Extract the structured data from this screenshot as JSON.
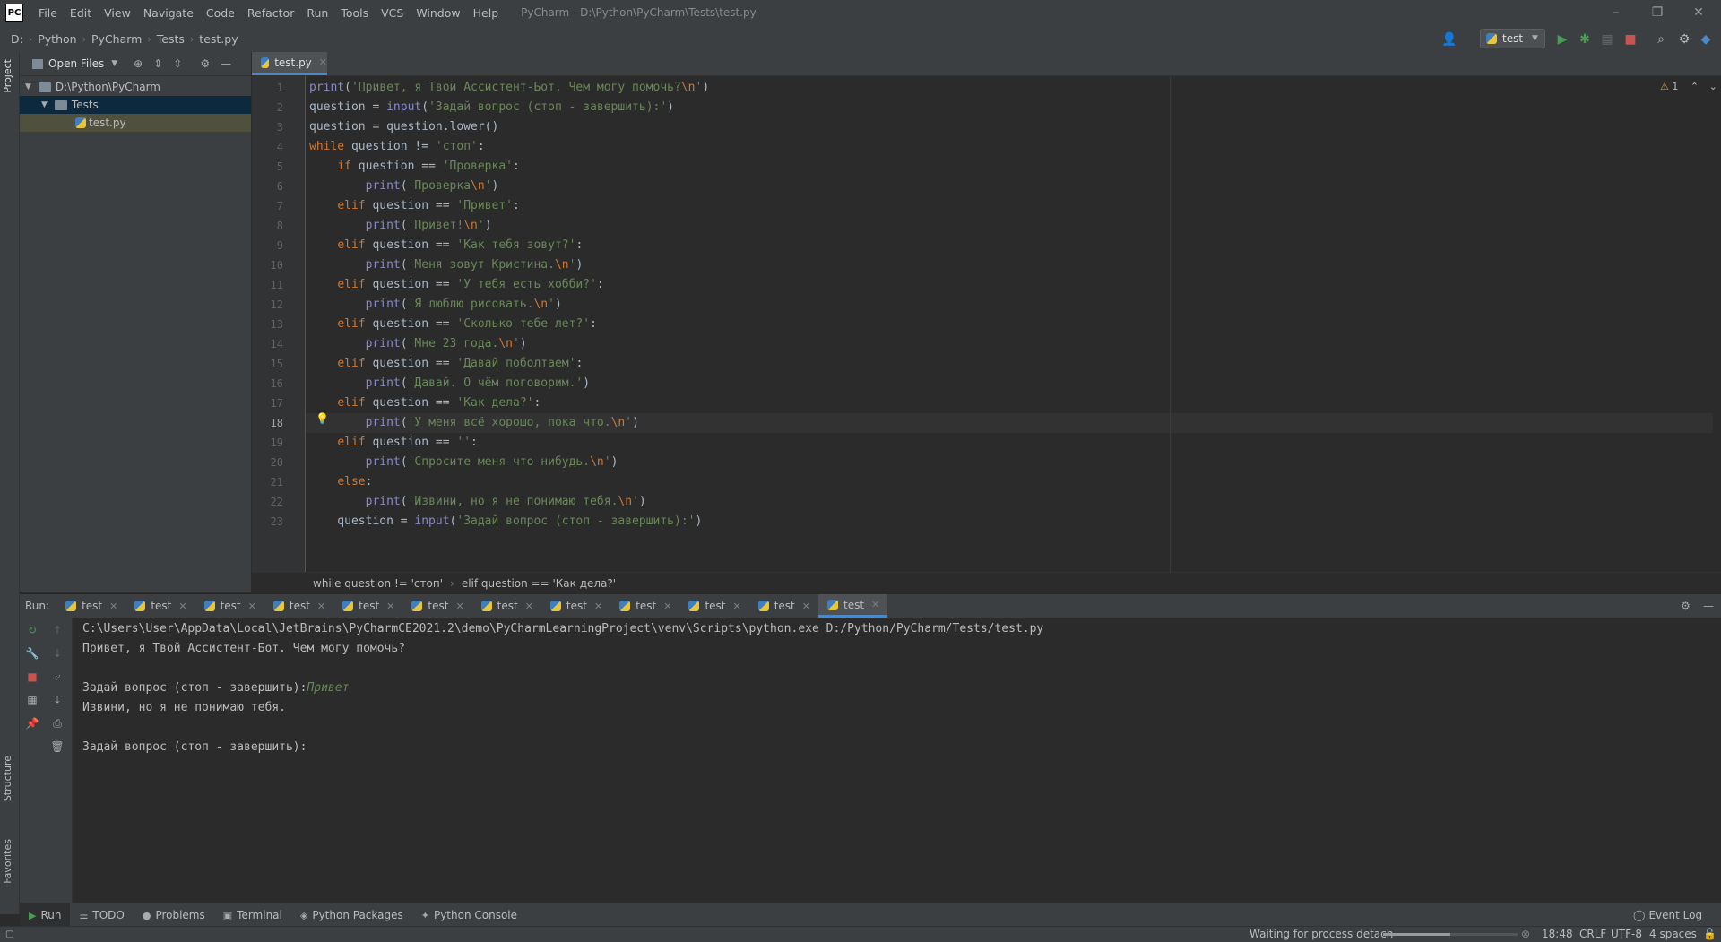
{
  "titlebar": {
    "logo": "PC",
    "menu": [
      "File",
      "Edit",
      "View",
      "Navigate",
      "Code",
      "Refactor",
      "Run",
      "Tools",
      "VCS",
      "Window",
      "Help"
    ],
    "title": "PyCharm - D:\\Python\\PyCharm\\Tests\\test.py",
    "controls": {
      "minimize": "–",
      "restore": "❐",
      "close": "✕"
    }
  },
  "navbar": {
    "breadcrumbs": [
      "D:",
      "Python",
      "PyCharm",
      "Tests",
      "test.py"
    ],
    "run_config": "test"
  },
  "left_strip": {
    "top_label": "Project",
    "structure_label": "Structure",
    "favorites_label": "Favorites"
  },
  "project_panel": {
    "selector": "Open Files",
    "tree": [
      {
        "label": "D:\\Python\\PyCharm",
        "type": "folder",
        "level": 0
      },
      {
        "label": "Tests",
        "type": "folder",
        "level": 1
      },
      {
        "label": "test.py",
        "type": "file",
        "level": 2
      }
    ]
  },
  "editor": {
    "tab": "test.py",
    "inspection_count": "1",
    "lines": [
      [
        [
          "bi",
          "print"
        ],
        [
          "pl",
          "("
        ],
        [
          "str",
          "'Привет, я Твой Ассистент-Бот. Чем могу помочь?"
        ],
        [
          "esc",
          "\\n"
        ],
        [
          "str",
          "'"
        ],
        [
          "pl",
          ")"
        ]
      ],
      [
        [
          "pl",
          "question = "
        ],
        [
          "bi",
          "input"
        ],
        [
          "pl",
          "("
        ],
        [
          "str",
          "'Задай вопрос (стоп - завершить):'"
        ],
        [
          "pl",
          ")"
        ]
      ],
      [
        [
          "pl",
          "question = question.lower()"
        ]
      ],
      [
        [
          "kw",
          "while"
        ],
        [
          "pl",
          " question != "
        ],
        [
          "str",
          "'стоп'"
        ],
        [
          "pl",
          ":"
        ]
      ],
      [
        [
          "pl",
          "    "
        ],
        [
          "kw",
          "if"
        ],
        [
          "pl",
          " question == "
        ],
        [
          "str",
          "'Проверка'"
        ],
        [
          "pl",
          ":"
        ]
      ],
      [
        [
          "pl",
          "        "
        ],
        [
          "bi",
          "print"
        ],
        [
          "pl",
          "("
        ],
        [
          "str",
          "'Проверка"
        ],
        [
          "esc",
          "\\n"
        ],
        [
          "str",
          "'"
        ],
        [
          "pl",
          ")"
        ]
      ],
      [
        [
          "pl",
          "    "
        ],
        [
          "kw",
          "elif"
        ],
        [
          "pl",
          " question == "
        ],
        [
          "str",
          "'Привет'"
        ],
        [
          "pl",
          ":"
        ]
      ],
      [
        [
          "pl",
          "        "
        ],
        [
          "bi",
          "print"
        ],
        [
          "pl",
          "("
        ],
        [
          "str",
          "'Привет!"
        ],
        [
          "esc",
          "\\n"
        ],
        [
          "str",
          "'"
        ],
        [
          "pl",
          ")"
        ]
      ],
      [
        [
          "pl",
          "    "
        ],
        [
          "kw",
          "elif"
        ],
        [
          "pl",
          " question == "
        ],
        [
          "str",
          "'Как тебя зовут?'"
        ],
        [
          "pl",
          ":"
        ]
      ],
      [
        [
          "pl",
          "        "
        ],
        [
          "bi",
          "print"
        ],
        [
          "pl",
          "("
        ],
        [
          "str",
          "'Меня зовут Кристина."
        ],
        [
          "esc",
          "\\n"
        ],
        [
          "str",
          "'"
        ],
        [
          "pl",
          ")"
        ]
      ],
      [
        [
          "pl",
          "    "
        ],
        [
          "kw",
          "elif"
        ],
        [
          "pl",
          " question == "
        ],
        [
          "str",
          "'У тебя есть хобби?'"
        ],
        [
          "pl",
          ":"
        ]
      ],
      [
        [
          "pl",
          "        "
        ],
        [
          "bi",
          "print"
        ],
        [
          "pl",
          "("
        ],
        [
          "str",
          "'Я люблю рисовать."
        ],
        [
          "esc",
          "\\n"
        ],
        [
          "str",
          "'"
        ],
        [
          "pl",
          ")"
        ]
      ],
      [
        [
          "pl",
          "    "
        ],
        [
          "kw",
          "elif"
        ],
        [
          "pl",
          " question == "
        ],
        [
          "str",
          "'Сколько тебе лет?'"
        ],
        [
          "pl",
          ":"
        ]
      ],
      [
        [
          "pl",
          "        "
        ],
        [
          "bi",
          "print"
        ],
        [
          "pl",
          "("
        ],
        [
          "str",
          "'Мне 23 года."
        ],
        [
          "esc",
          "\\n"
        ],
        [
          "str",
          "'"
        ],
        [
          "pl",
          ")"
        ]
      ],
      [
        [
          "pl",
          "    "
        ],
        [
          "kw",
          "elif"
        ],
        [
          "pl",
          " question == "
        ],
        [
          "str",
          "'Давай поболтаем'"
        ],
        [
          "pl",
          ":"
        ]
      ],
      [
        [
          "pl",
          "        "
        ],
        [
          "bi",
          "print"
        ],
        [
          "pl",
          "("
        ],
        [
          "str",
          "'Давай. О чём поговорим.'"
        ],
        [
          "pl",
          ")"
        ]
      ],
      [
        [
          "pl",
          "    "
        ],
        [
          "kw",
          "elif"
        ],
        [
          "pl",
          " question == "
        ],
        [
          "str",
          "'Как дела?'"
        ],
        [
          "pl",
          ":"
        ]
      ],
      [
        [
          "pl",
          "        "
        ],
        [
          "bi",
          "print"
        ],
        [
          "pl",
          "("
        ],
        [
          "str",
          "'У меня всё хорошо, пока что."
        ],
        [
          "esc",
          "\\n"
        ],
        [
          "str",
          "'"
        ],
        [
          "pl",
          ")"
        ]
      ],
      [
        [
          "pl",
          "    "
        ],
        [
          "kw",
          "elif"
        ],
        [
          "pl",
          " question == "
        ],
        [
          "str",
          "''"
        ],
        [
          "pl",
          ":"
        ]
      ],
      [
        [
          "pl",
          "        "
        ],
        [
          "bi",
          "print"
        ],
        [
          "pl",
          "("
        ],
        [
          "str",
          "'Спросите меня что-нибудь."
        ],
        [
          "esc",
          "\\n"
        ],
        [
          "str",
          "'"
        ],
        [
          "pl",
          ")"
        ]
      ],
      [
        [
          "pl",
          "    "
        ],
        [
          "kw",
          "else"
        ],
        [
          "pl",
          ":"
        ]
      ],
      [
        [
          "pl",
          "        "
        ],
        [
          "bi",
          "print"
        ],
        [
          "pl",
          "("
        ],
        [
          "str",
          "'Извини, но я не понимаю тебя."
        ],
        [
          "esc",
          "\\n"
        ],
        [
          "str",
          "'"
        ],
        [
          "pl",
          ")"
        ]
      ],
      [
        [
          "pl",
          "    question = "
        ],
        [
          "bi",
          "input"
        ],
        [
          "pl",
          "("
        ],
        [
          "str",
          "'Задай вопрос (стоп - завершить):'"
        ],
        [
          "pl",
          ")"
        ]
      ]
    ],
    "breadcrumbs": [
      "while question != 'стоп'",
      "elif question == 'Как дела?'"
    ]
  },
  "run_panel": {
    "label": "Run:",
    "tabs": [
      "test",
      "test",
      "test",
      "test",
      "test",
      "test",
      "test",
      "test",
      "test",
      "test",
      "test",
      "test"
    ],
    "active_tab_index": 11,
    "console_lines": [
      "C:\\Users\\User\\AppData\\Local\\JetBrains\\PyCharmCE2021.2\\demo\\PyCharmLearningProject\\venv\\Scripts\\python.exe D:/Python/PyCharm/Tests/test.py",
      "Привет, я Твой Ассистент-Бот. Чем могу помочь?",
      "",
      "Задай вопрос (стоп - завершить):",
      "Извини, но я не понимаю тебя.",
      "",
      "Задай вопрос (стоп - завершить):"
    ],
    "user_input": "Привет"
  },
  "tool_tabs": {
    "items": [
      {
        "icon": "▶",
        "label": "Run"
      },
      {
        "icon": "☰",
        "label": "TODO"
      },
      {
        "icon": "●",
        "label": "Problems"
      },
      {
        "icon": "▣",
        "label": "Terminal"
      },
      {
        "icon": "◈",
        "label": "Python Packages"
      },
      {
        "icon": "✦",
        "label": "Python Console"
      }
    ],
    "event_log": "Event Log"
  },
  "statusbar": {
    "message": "Waiting for process detach",
    "position": "18:48",
    "line_sep": "CRLF",
    "encoding": "UTF-8",
    "indent": "4 spaces",
    "progress": 0.5
  },
  "colors": {
    "accent": "#4a88c7",
    "keyword": "#cc7832",
    "string": "#6a8759",
    "builtin": "#8888c6",
    "input": "#6a8759"
  }
}
